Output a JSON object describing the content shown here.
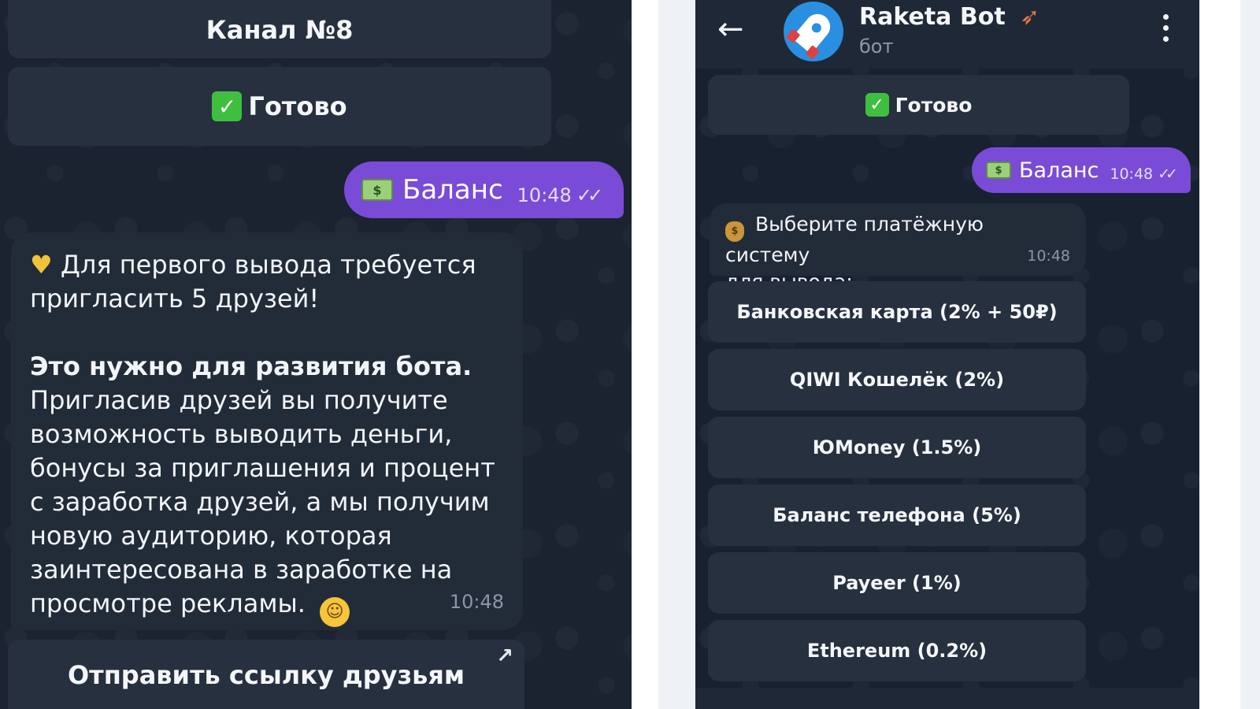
{
  "left": {
    "channel_button": "Канал №8",
    "done_button": "Готово",
    "outgoing": {
      "text": "Баланс",
      "time": "10:48"
    },
    "message": {
      "line1": "Для первого вывода требуется",
      "line2": "пригласить 5 друзей!",
      "bold_line": "Это нужно для развития бота.",
      "body_lines": [
        "Пригласив друзей вы получите",
        "возможность выводить деньги,",
        "бонусы за приглашения и процент",
        "с заработка друзей, а мы получим",
        "новую аудиторию, которая",
        "заинтересована в заработке на",
        "просмотре рекламы."
      ],
      "time": "10:48"
    },
    "share_button": "Отправить ссылку друзьям"
  },
  "right": {
    "header": {
      "title": "Raketa Bot",
      "subtitle": "бот"
    },
    "done_button": "Готово",
    "outgoing": {
      "text": "Баланс",
      "time": "10:48"
    },
    "message": {
      "line1": "Выберите платёжную систему",
      "line2": "для вывода:",
      "time": "10:48"
    },
    "payment_options": [
      "Банковская карта (2% + 50₽)",
      "QIWI Кошелёк (2%)",
      "ЮMoney (1.5%)",
      "Баланс телефона (5%)",
      "Payeer (1%)",
      "Ethereum (0.2%)"
    ]
  },
  "colors": {
    "chat_bg": "#1b2230",
    "button_bg": "#27303e",
    "outgoing_bubble": "#7a4bd6",
    "incoming_bubble": "#222b38",
    "accent_green": "#3fbf3f"
  },
  "icons": [
    "back-arrow-icon",
    "rocket-avatar-icon",
    "rocket-emoji-icon",
    "more-vertical-icon",
    "check-mark-icon",
    "cash-icon",
    "double-check-icon",
    "yellow-heart-icon",
    "money-bag-icon",
    "smile-emoji-icon",
    "external-link-icon"
  ]
}
